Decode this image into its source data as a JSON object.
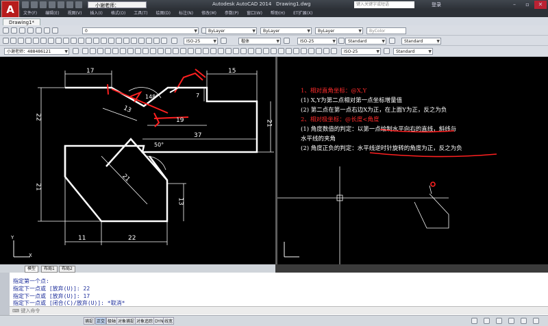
{
  "window": {
    "app_title": "Autodesk AutoCAD 2014",
    "doc_title": "Drawing1.dwg",
    "workspace": "小谢老师：488486121",
    "search_placeholder": "键入关键字或短语",
    "login": "登录",
    "logo": "A"
  },
  "menu": [
    "文件(F)",
    "编辑(E)",
    "视图(V)",
    "插入(I)",
    "格式(O)",
    "工具(T)",
    "绘图(D)",
    "标注(N)",
    "修改(M)",
    "参数(P)",
    "窗口(W)",
    "帮助(H)",
    "ET扩展(X)"
  ],
  "doc_tab": "Drawing1*",
  "toolbar": {
    "layer_value": "0",
    "color": "ByLayer",
    "linetype": "ByLayer",
    "lineweight": "ByLayer",
    "plotstyle": "ByColor",
    "dimstyle": "ISO-25",
    "textstyle_label": "楷体",
    "dimstyle2": "ISO-25",
    "tablestyle": "Standard",
    "multileader": "Standard",
    "workspace2": "小谢老师：488486121",
    "dimstyle3": "ISO-25",
    "textstyle2": "Standard"
  },
  "drawing": {
    "dims": [
      "17",
      "15",
      "148°",
      "13",
      "7",
      "19",
      "37",
      "22",
      "21",
      "21",
      "50°",
      "21",
      "13",
      "11",
      "22"
    ]
  },
  "notes": [
    {
      "text": "1、相对直角坐标：@X,Y",
      "red": true
    },
    {
      "text": "(1) X,Y为第二点相对第一点坐标增量值",
      "red": false
    },
    {
      "text": "(2) 第二点在第一点右边X为正，在上面Y为正，反之为负",
      "red": false
    },
    {
      "text": "2、相对极坐标：@长度<角度",
      "red": true
    },
    {
      "text": "(1) 角度数值的判定：以第一点绘制水平向右的直线，斜线与",
      "red": false
    },
    {
      "text": "水平线的夹角",
      "red": false
    },
    {
      "text": "(2) 角度正负的判定：水平线逆时针旋转的角度为正，反之为负",
      "red": false
    }
  ],
  "layout_tabs": [
    "模型",
    "布局1",
    "布局2"
  ],
  "command_lines": [
    "指定第一个点:",
    "指定下一点或 [放弃(U)]: 22",
    "指定下一点或 [放弃(U)]: 17",
    "指定下一点或 [闭合(C)/放弃(U)]: *取消*"
  ],
  "command_prompt": "键入命令",
  "status_buttons": [
    "捕捉",
    "正交",
    "极轴",
    "对象捕捉",
    "对象追踪",
    "DYN",
    "线宽"
  ],
  "axis_labels": {
    "y": "Y",
    "x": "X"
  },
  "colors": {
    "canvas": "#000000",
    "red": "#ff2020",
    "command_text": "#1a2b9a"
  }
}
